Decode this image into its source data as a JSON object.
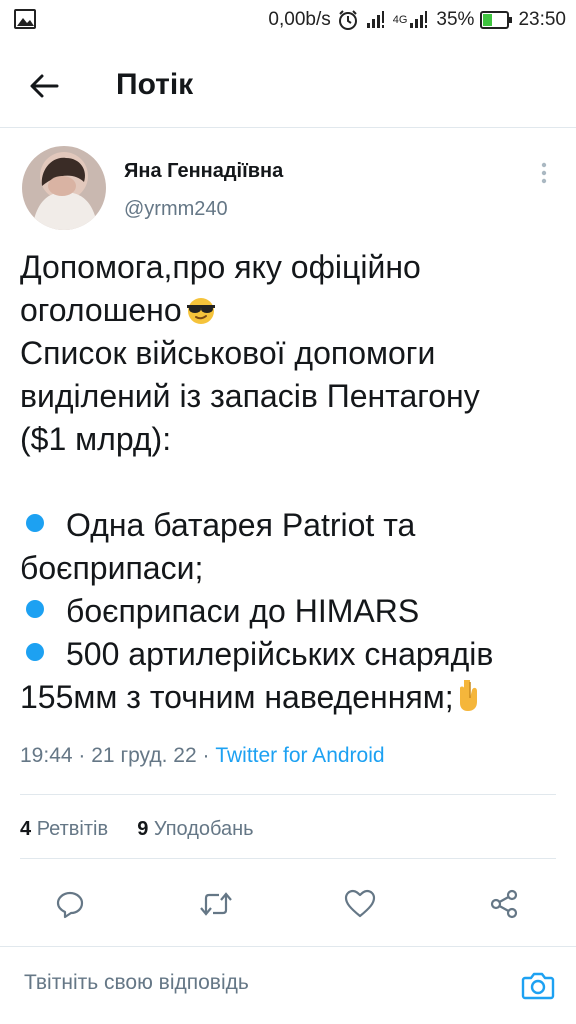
{
  "status_bar": {
    "net_speed": "0,00b/s",
    "network_type": "4G",
    "battery_percent": "35%",
    "time": "23:50",
    "icons": [
      "gallery-icon",
      "alarm-icon",
      "signal-icon",
      "battery-icon"
    ]
  },
  "app_bar": {
    "title": "Потік",
    "back_icon": "arrow-left-icon"
  },
  "tweet": {
    "author_name": "Яна Геннадіївна",
    "author_handle": "@yrmm240",
    "text_lines": [
      "Допомога,про яку офіційно",
      "оголошено",
      "Список військової допомоги",
      "виділений із запасів Пентагону",
      "($1 млрд):",
      "",
      "Одна батарея Patriot та",
      "боєприпаси;",
      "боєприпаси до HIMARS",
      "500 артилерійських снарядів",
      "155мм з точним наведенням;"
    ],
    "emoji": [
      "sunglasses-emoji",
      "point-down-emoji"
    ],
    "time": "19:44",
    "date": "21 груд. 22",
    "source": "Twitter for Android",
    "separator": "·"
  },
  "stats": {
    "retweets_count": "4",
    "retweets_label": "Ретвітів",
    "likes_count": "9",
    "likes_label": "Уподобань"
  },
  "actions": [
    "reply-icon",
    "retweet-icon",
    "like-icon",
    "share-icon"
  ],
  "reply_bar": {
    "placeholder": "Твітніть свою відповідь",
    "camera_icon": "camera-icon"
  },
  "colors": {
    "accent": "#1da1f2",
    "text": "#14171a",
    "secondary": "#657786",
    "divider": "#e1e8ed",
    "battery_fill": "#3fc43f"
  }
}
